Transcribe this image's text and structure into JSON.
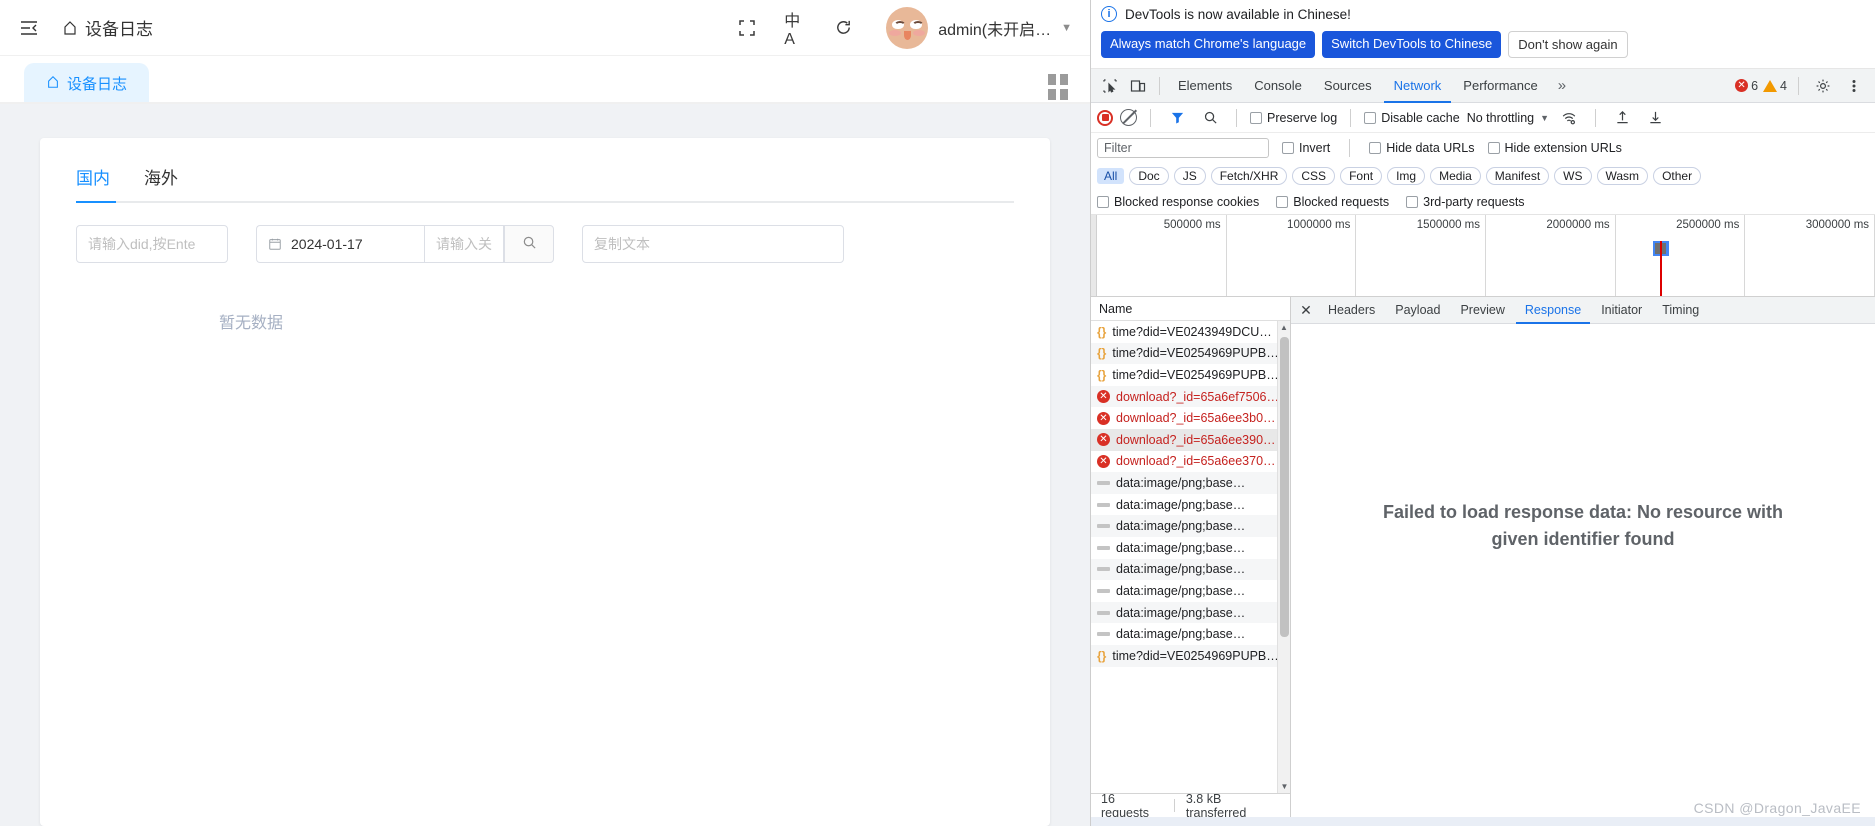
{
  "app": {
    "header": {
      "collapse_icon": "menu-fold-icon",
      "breadcrumb_home_icon": "home-icon",
      "breadcrumb_title": "设备日志",
      "fullscreen_icon": "fullscreen-icon",
      "language_icon": "中A",
      "refresh_icon": "refresh-icon",
      "avatar_icon": "user-avatar",
      "user_name": "admin(未开启…",
      "caret_icon": "chevron-down-icon"
    },
    "tabbar": {
      "tab_home_icon": "home-icon",
      "tab_label": "设备日志",
      "grid_icon": "grid-menu-icon"
    },
    "inner_tabs": [
      {
        "label": "国内",
        "active": true
      },
      {
        "label": "海外",
        "active": false
      }
    ],
    "filters": {
      "did_placeholder": "请输入did,按Ente",
      "date_icon": "calendar-icon",
      "date_value": "2024-01-17",
      "keyword_placeholder": "请输入关",
      "search_icon": "search-icon",
      "copy_placeholder": "复制文本"
    },
    "empty_text": "暂无数据"
  },
  "devtools": {
    "banner": {
      "info_icon": "info-circle-icon",
      "message": "DevTools is now available in Chinese!",
      "btn_always_match": "Always match Chrome's language",
      "btn_switch": "Switch DevTools to Chinese",
      "btn_dismiss": "Don't show again"
    },
    "tabs": {
      "inspect_icon": "inspect-element-icon",
      "device_icon": "device-toolbar-icon",
      "items": [
        {
          "label": "Elements",
          "active": false
        },
        {
          "label": "Console",
          "active": false
        },
        {
          "label": "Sources",
          "active": false
        },
        {
          "label": "Network",
          "active": true
        },
        {
          "label": "Performance",
          "active": false
        }
      ],
      "more_icon": "»",
      "error_count": "6",
      "warning_count": "4",
      "settings_icon": "gear-icon",
      "kebab_icon": "more-vertical-icon"
    },
    "toolbar": {
      "record_icon": "record-stop-icon",
      "clear_icon": "clear-icon",
      "filter_icon": "filter-icon",
      "search_icon": "search-icon",
      "preserve_log": "Preserve log",
      "disable_cache": "Disable cache",
      "throttling": "No throttling",
      "throttle_caret": "chevron-down-icon",
      "wifi_icon": "network-conditions-icon",
      "import_icon": "import-har-icon",
      "export_icon": "export-har-icon"
    },
    "filter_row": {
      "filter_placeholder": "Filter",
      "invert": "Invert",
      "hide_data_urls": "Hide data URLs",
      "hide_extension_urls": "Hide extension URLs"
    },
    "type_chips": [
      {
        "label": "All",
        "active": true
      },
      {
        "label": "Doc",
        "active": false
      },
      {
        "label": "JS",
        "active": false
      },
      {
        "label": "Fetch/XHR",
        "active": false
      },
      {
        "label": "CSS",
        "active": false
      },
      {
        "label": "Font",
        "active": false
      },
      {
        "label": "Img",
        "active": false
      },
      {
        "label": "Media",
        "active": false
      },
      {
        "label": "Manifest",
        "active": false
      },
      {
        "label": "WS",
        "active": false
      },
      {
        "label": "Wasm",
        "active": false
      },
      {
        "label": "Other",
        "active": false
      }
    ],
    "extra_checks": [
      "Blocked response cookies",
      "Blocked requests",
      "3rd-party requests"
    ],
    "overview_ticks": [
      "500000 ms",
      "1000000 ms",
      "1500000 ms",
      "2000000 ms",
      "2500000 ms",
      "3000000 ms"
    ],
    "requests": {
      "column_name": "Name",
      "rows": [
        {
          "name": "time?did=VE0243949DCU…",
          "type": "json",
          "selected": false
        },
        {
          "name": "time?did=VE0254969PUPB…",
          "type": "json",
          "selected": false
        },
        {
          "name": "time?did=VE0254969PUPB…",
          "type": "json",
          "selected": false
        },
        {
          "name": "download?_id=65a6ef7506…",
          "type": "error",
          "selected": false
        },
        {
          "name": "download?_id=65a6ee3b0…",
          "type": "error",
          "selected": false
        },
        {
          "name": "download?_id=65a6ee390…",
          "type": "error",
          "selected": true
        },
        {
          "name": "download?_id=65a6ee370…",
          "type": "error",
          "selected": false
        },
        {
          "name": "data:image/png;base…",
          "type": "data",
          "selected": false
        },
        {
          "name": "data:image/png;base…",
          "type": "data",
          "selected": false
        },
        {
          "name": "data:image/png;base…",
          "type": "data",
          "selected": false
        },
        {
          "name": "data:image/png;base…",
          "type": "data",
          "selected": false
        },
        {
          "name": "data:image/png;base…",
          "type": "data",
          "selected": false
        },
        {
          "name": "data:image/png;base…",
          "type": "data",
          "selected": false
        },
        {
          "name": "data:image/png;base…",
          "type": "data",
          "selected": false
        },
        {
          "name": "data:image/png;base…",
          "type": "data",
          "selected": false
        },
        {
          "name": "time?did=VE0254969PUPB…",
          "type": "json",
          "selected": false
        }
      ],
      "status_requests": "16 requests",
      "status_transferred": "3.8 kB transferred"
    },
    "detail": {
      "close_icon": "close-icon",
      "tabs": [
        {
          "label": "Headers",
          "active": false
        },
        {
          "label": "Payload",
          "active": false
        },
        {
          "label": "Preview",
          "active": false
        },
        {
          "label": "Response",
          "active": true
        },
        {
          "label": "Initiator",
          "active": false
        },
        {
          "label": "Timing",
          "active": false
        }
      ],
      "failure_message": "Failed to load response data: No resource with given identifier found"
    }
  },
  "watermark": "CSDN @Dragon_JavaEE",
  "colors": {
    "accent_blue": "#1890ff",
    "devtools_blue": "#1a73e8",
    "error_red": "#d93025",
    "warn_orange": "#f29900"
  }
}
